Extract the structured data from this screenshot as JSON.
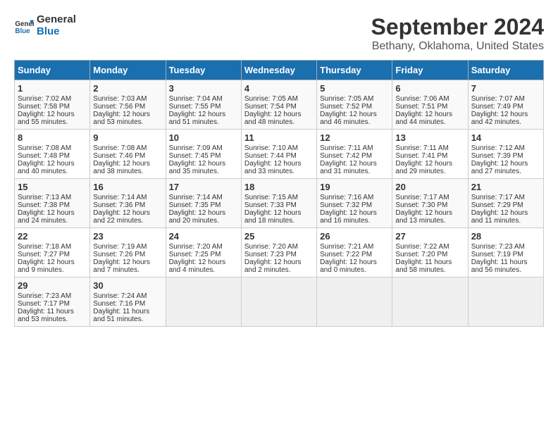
{
  "header": {
    "logo_line1": "General",
    "logo_line2": "Blue",
    "title": "September 2024",
    "subtitle": "Bethany, Oklahoma, United States"
  },
  "days_of_week": [
    "Sunday",
    "Monday",
    "Tuesday",
    "Wednesday",
    "Thursday",
    "Friday",
    "Saturday"
  ],
  "weeks": [
    [
      {
        "day": "1",
        "lines": [
          "Sunrise: 7:02 AM",
          "Sunset: 7:58 PM",
          "Daylight: 12 hours",
          "and 55 minutes."
        ]
      },
      {
        "day": "2",
        "lines": [
          "Sunrise: 7:03 AM",
          "Sunset: 7:56 PM",
          "Daylight: 12 hours",
          "and 53 minutes."
        ]
      },
      {
        "day": "3",
        "lines": [
          "Sunrise: 7:04 AM",
          "Sunset: 7:55 PM",
          "Daylight: 12 hours",
          "and 51 minutes."
        ]
      },
      {
        "day": "4",
        "lines": [
          "Sunrise: 7:05 AM",
          "Sunset: 7:54 PM",
          "Daylight: 12 hours",
          "and 48 minutes."
        ]
      },
      {
        "day": "5",
        "lines": [
          "Sunrise: 7:05 AM",
          "Sunset: 7:52 PM",
          "Daylight: 12 hours",
          "and 46 minutes."
        ]
      },
      {
        "day": "6",
        "lines": [
          "Sunrise: 7:06 AM",
          "Sunset: 7:51 PM",
          "Daylight: 12 hours",
          "and 44 minutes."
        ]
      },
      {
        "day": "7",
        "lines": [
          "Sunrise: 7:07 AM",
          "Sunset: 7:49 PM",
          "Daylight: 12 hours",
          "and 42 minutes."
        ]
      }
    ],
    [
      {
        "day": "8",
        "lines": [
          "Sunrise: 7:08 AM",
          "Sunset: 7:48 PM",
          "Daylight: 12 hours",
          "and 40 minutes."
        ]
      },
      {
        "day": "9",
        "lines": [
          "Sunrise: 7:08 AM",
          "Sunset: 7:46 PM",
          "Daylight: 12 hours",
          "and 38 minutes."
        ]
      },
      {
        "day": "10",
        "lines": [
          "Sunrise: 7:09 AM",
          "Sunset: 7:45 PM",
          "Daylight: 12 hours",
          "and 35 minutes."
        ]
      },
      {
        "day": "11",
        "lines": [
          "Sunrise: 7:10 AM",
          "Sunset: 7:44 PM",
          "Daylight: 12 hours",
          "and 33 minutes."
        ]
      },
      {
        "day": "12",
        "lines": [
          "Sunrise: 7:11 AM",
          "Sunset: 7:42 PM",
          "Daylight: 12 hours",
          "and 31 minutes."
        ]
      },
      {
        "day": "13",
        "lines": [
          "Sunrise: 7:11 AM",
          "Sunset: 7:41 PM",
          "Daylight: 12 hours",
          "and 29 minutes."
        ]
      },
      {
        "day": "14",
        "lines": [
          "Sunrise: 7:12 AM",
          "Sunset: 7:39 PM",
          "Daylight: 12 hours",
          "and 27 minutes."
        ]
      }
    ],
    [
      {
        "day": "15",
        "lines": [
          "Sunrise: 7:13 AM",
          "Sunset: 7:38 PM",
          "Daylight: 12 hours",
          "and 24 minutes."
        ]
      },
      {
        "day": "16",
        "lines": [
          "Sunrise: 7:14 AM",
          "Sunset: 7:36 PM",
          "Daylight: 12 hours",
          "and 22 minutes."
        ]
      },
      {
        "day": "17",
        "lines": [
          "Sunrise: 7:14 AM",
          "Sunset: 7:35 PM",
          "Daylight: 12 hours",
          "and 20 minutes."
        ]
      },
      {
        "day": "18",
        "lines": [
          "Sunrise: 7:15 AM",
          "Sunset: 7:33 PM",
          "Daylight: 12 hours",
          "and 18 minutes."
        ]
      },
      {
        "day": "19",
        "lines": [
          "Sunrise: 7:16 AM",
          "Sunset: 7:32 PM",
          "Daylight: 12 hours",
          "and 16 minutes."
        ]
      },
      {
        "day": "20",
        "lines": [
          "Sunrise: 7:17 AM",
          "Sunset: 7:30 PM",
          "Daylight: 12 hours",
          "and 13 minutes."
        ]
      },
      {
        "day": "21",
        "lines": [
          "Sunrise: 7:17 AM",
          "Sunset: 7:29 PM",
          "Daylight: 12 hours",
          "and 11 minutes."
        ]
      }
    ],
    [
      {
        "day": "22",
        "lines": [
          "Sunrise: 7:18 AM",
          "Sunset: 7:27 PM",
          "Daylight: 12 hours",
          "and 9 minutes."
        ]
      },
      {
        "day": "23",
        "lines": [
          "Sunrise: 7:19 AM",
          "Sunset: 7:26 PM",
          "Daylight: 12 hours",
          "and 7 minutes."
        ]
      },
      {
        "day": "24",
        "lines": [
          "Sunrise: 7:20 AM",
          "Sunset: 7:25 PM",
          "Daylight: 12 hours",
          "and 4 minutes."
        ]
      },
      {
        "day": "25",
        "lines": [
          "Sunrise: 7:20 AM",
          "Sunset: 7:23 PM",
          "Daylight: 12 hours",
          "and 2 minutes."
        ]
      },
      {
        "day": "26",
        "lines": [
          "Sunrise: 7:21 AM",
          "Sunset: 7:22 PM",
          "Daylight: 12 hours",
          "and 0 minutes."
        ]
      },
      {
        "day": "27",
        "lines": [
          "Sunrise: 7:22 AM",
          "Sunset: 7:20 PM",
          "Daylight: 11 hours",
          "and 58 minutes."
        ]
      },
      {
        "day": "28",
        "lines": [
          "Sunrise: 7:23 AM",
          "Sunset: 7:19 PM",
          "Daylight: 11 hours",
          "and 56 minutes."
        ]
      }
    ],
    [
      {
        "day": "29",
        "lines": [
          "Sunrise: 7:23 AM",
          "Sunset: 7:17 PM",
          "Daylight: 11 hours",
          "and 53 minutes."
        ]
      },
      {
        "day": "30",
        "lines": [
          "Sunrise: 7:24 AM",
          "Sunset: 7:16 PM",
          "Daylight: 11 hours",
          "and 51 minutes."
        ]
      },
      {
        "day": "",
        "lines": []
      },
      {
        "day": "",
        "lines": []
      },
      {
        "day": "",
        "lines": []
      },
      {
        "day": "",
        "lines": []
      },
      {
        "day": "",
        "lines": []
      }
    ]
  ]
}
